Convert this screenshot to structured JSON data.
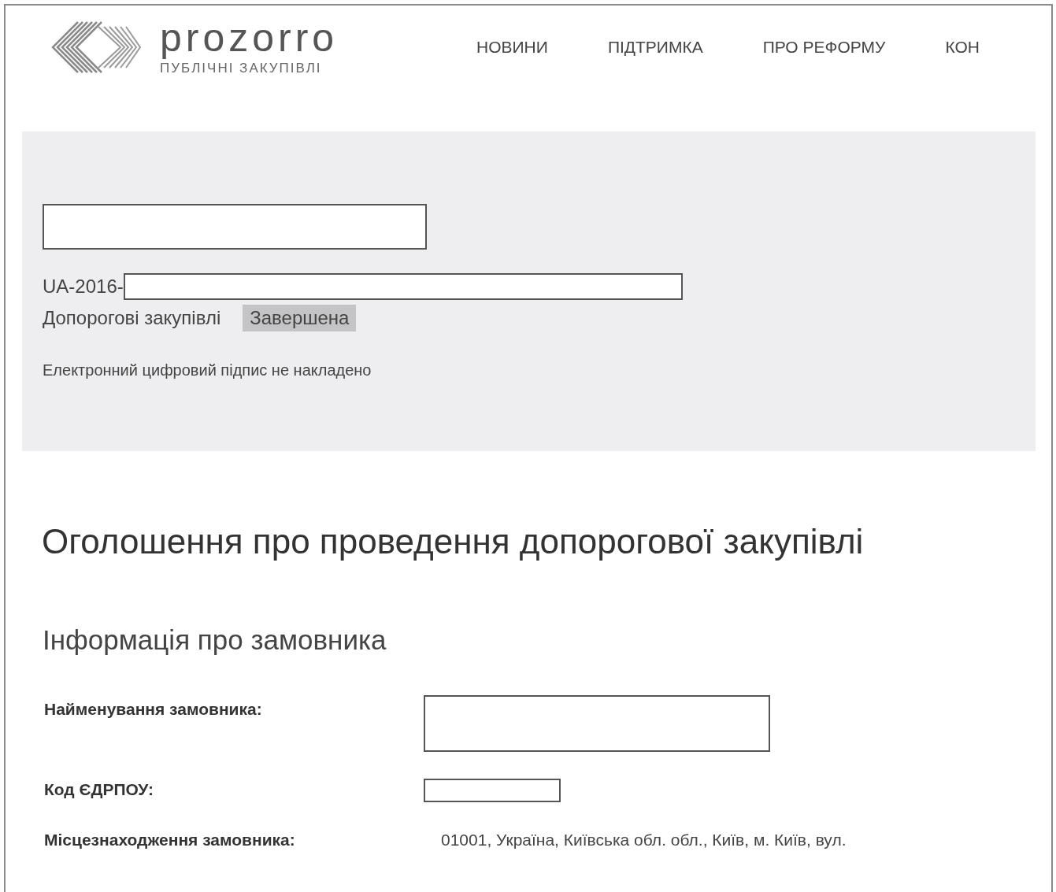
{
  "logo": {
    "name": "prozorro",
    "tagline": "ПУБЛІЧНІ ЗАКУПІВЛІ"
  },
  "nav": [
    "НОВИНИ",
    "ПІДТРИМКА",
    "ПРО РЕФОРМУ",
    "КОН"
  ],
  "tender": {
    "id_prefix": "UA-2016-",
    "procedure": "Допорогові закупівлі",
    "status": "Завершена",
    "signature_note": "Електронний цифровий підпис не накладено"
  },
  "title": "Оголошення про проведення допорогової закупівлі",
  "section": {
    "title": "Інформація про замовника",
    "fields": [
      {
        "label": "Найменування замовника:",
        "kind": "redacted_large"
      },
      {
        "label": "Код ЄДРПОУ:",
        "kind": "redacted_small"
      },
      {
        "label": "Місцезнаходження замовника:",
        "kind": "text",
        "value": "01001, Україна, Київська обл. обл., Київ, м. Київ, вул."
      }
    ]
  }
}
